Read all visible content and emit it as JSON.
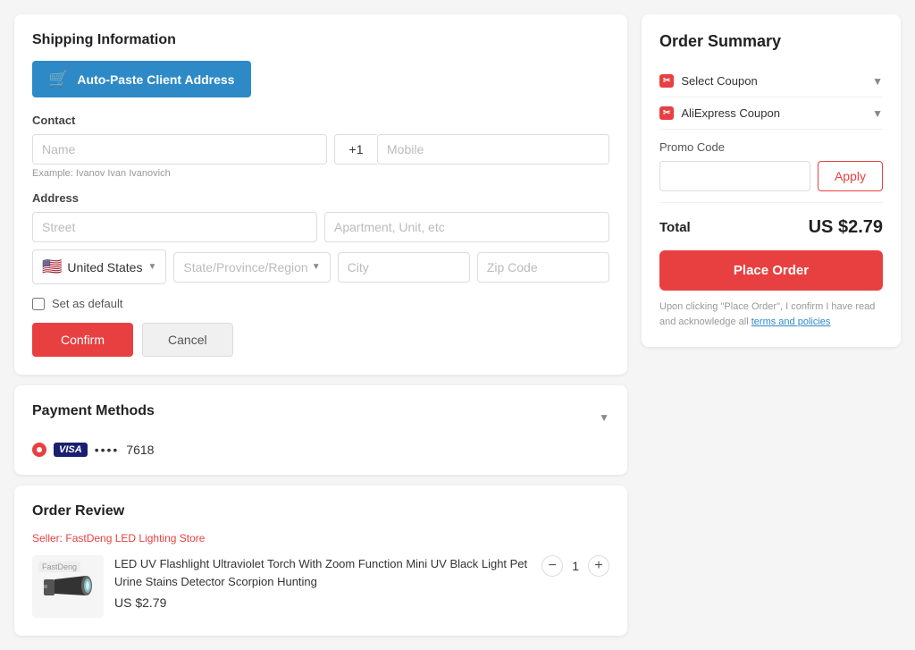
{
  "shipping": {
    "title": "Shipping Information",
    "auto_paste_label": "Auto-Paste Client Address",
    "contact_label": "Contact",
    "name_placeholder": "Name",
    "phone_code": "+1",
    "mobile_placeholder": "Mobile",
    "example_text": "Example: Ivanov Ivan Ivanovich",
    "address_label": "Address",
    "street_placeholder": "Street",
    "apartment_placeholder": "Apartment, Unit, etc",
    "country_label": "United States",
    "state_placeholder": "State/Province/Region",
    "city_placeholder": "City",
    "zip_placeholder": "Zip Code",
    "set_default_label": "Set as default",
    "confirm_label": "Confirm",
    "cancel_label": "Cancel"
  },
  "payment": {
    "title": "Payment Methods",
    "card_brand": "VISA",
    "card_dots": "••••",
    "card_last4": "7618"
  },
  "order_review": {
    "title": "Order Review",
    "seller_prefix": "Seller:",
    "seller_name": "FastDeng LED Lighting Store",
    "product_title": "LED UV Flashlight Ultraviolet Torch With Zoom Function Mini UV Black Light Pet Urine Stains Detector Scorpion Hunting",
    "product_price": "US $2.79",
    "product_qty": "1",
    "brand_label": "FastDeng"
  },
  "order_summary": {
    "title": "Order Summary",
    "select_coupon_label": "Select Coupon",
    "aliexpress_coupon_label": "AliExpress Coupon",
    "promo_code_label": "Promo Code",
    "promo_placeholder": "",
    "apply_label": "Apply",
    "total_label": "Total",
    "total_value": "US $2.79",
    "place_order_label": "Place Order",
    "terms_text": "Upon clicking \"Place Order\", I confirm I have read and acknowledge all ",
    "terms_link": "terms and policies"
  }
}
